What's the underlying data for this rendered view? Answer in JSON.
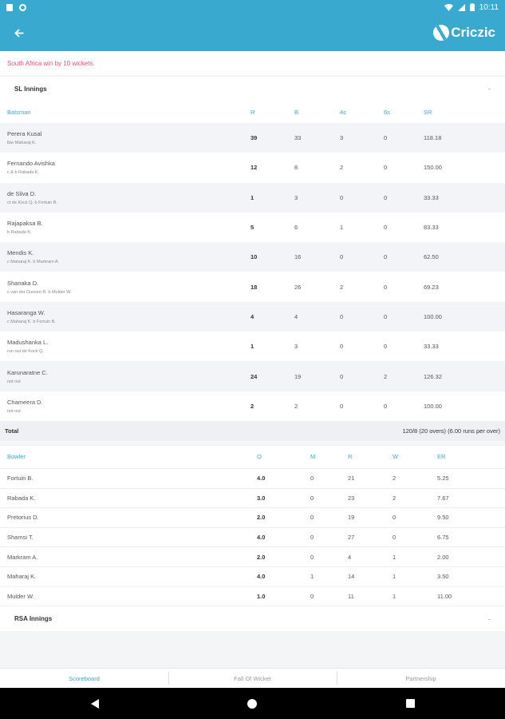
{
  "status_bar": {
    "time": "10:11"
  },
  "app": {
    "logo_text": "Criczic"
  },
  "result_text": "South Africa win by 10 wickets.",
  "sl_innings": {
    "title": "SL Innings",
    "toggle": "-",
    "headers": {
      "batsman": "Batsman",
      "r": "R",
      "b": "B",
      "fours": "4s",
      "sixes": "6s",
      "sr": "SR"
    },
    "rows": [
      {
        "name": "Perera Kusal",
        "dismissal": "lbw Maharaj K.",
        "r": "39",
        "b": "33",
        "fours": "3",
        "sixes": "0",
        "sr": "118.18"
      },
      {
        "name": "Fernando Avishka",
        "dismissal": "c & b Rabada K.",
        "r": "12",
        "b": "8",
        "fours": "2",
        "sixes": "0",
        "sr": "150.00"
      },
      {
        "name": "de Silva D.",
        "dismissal": "ct de Kock Q. b Fortuin B.",
        "r": "1",
        "b": "3",
        "fours": "0",
        "sixes": "0",
        "sr": "33.33"
      },
      {
        "name": "Rajapaksa B.",
        "dismissal": "b Rabada K.",
        "r": "5",
        "b": "6",
        "fours": "1",
        "sixes": "0",
        "sr": "83.33"
      },
      {
        "name": "Mendis K.",
        "dismissal": "c Maharaj K. b Markram A.",
        "r": "10",
        "b": "16",
        "fours": "0",
        "sixes": "0",
        "sr": "62.50"
      },
      {
        "name": "Shanaka D.",
        "dismissal": "c van der Dussen R. b Mulder W.",
        "r": "18",
        "b": "26",
        "fours": "2",
        "sixes": "0",
        "sr": "69.23"
      },
      {
        "name": "Hasaranga W.",
        "dismissal": "c Maharaj K. b Fortuin B.",
        "r": "4",
        "b": "4",
        "fours": "0",
        "sixes": "0",
        "sr": "100.00"
      },
      {
        "name": "Madushanka L.",
        "dismissal": "run out de Kock Q.",
        "r": "1",
        "b": "3",
        "fours": "0",
        "sixes": "0",
        "sr": "33.33"
      },
      {
        "name": "Karunaratne C.",
        "dismissal": "not out",
        "r": "24",
        "b": "19",
        "fours": "0",
        "sixes": "2",
        "sr": "126.32"
      },
      {
        "name": "Chameera D.",
        "dismissal": "not out",
        "r": "2",
        "b": "2",
        "fours": "0",
        "sixes": "0",
        "sr": "100.00"
      }
    ],
    "total_label": "Total",
    "total_value": "120/8 (20 overs) (6.00 runs per over)",
    "bowl_headers": {
      "bowler": "Bowler",
      "o": "O",
      "m": "M",
      "r": "R",
      "w": "W",
      "er": "ER"
    },
    "bowlers": [
      {
        "name": "Fortuin B.",
        "o": "4.0",
        "m": "0",
        "r": "21",
        "w": "2",
        "er": "5.25"
      },
      {
        "name": "Rabada K.",
        "o": "3.0",
        "m": "0",
        "r": "23",
        "w": "2",
        "er": "7.67"
      },
      {
        "name": "Pretorius D.",
        "o": "2.0",
        "m": "0",
        "r": "19",
        "w": "0",
        "er": "9.50"
      },
      {
        "name": "Shamsi T.",
        "o": "4.0",
        "m": "0",
        "r": "27",
        "w": "0",
        "er": "6.75"
      },
      {
        "name": "Markram A.",
        "o": "2.0",
        "m": "0",
        "r": "4",
        "w": "1",
        "er": "2.00"
      },
      {
        "name": "Maharaj K.",
        "o": "4.0",
        "m": "1",
        "r": "14",
        "w": "1",
        "er": "3.50"
      },
      {
        "name": "Mulder W.",
        "o": "1.0",
        "m": "0",
        "r": "11",
        "w": "1",
        "er": "11.00"
      }
    ]
  },
  "rsa_innings": {
    "title": "RSA Innings",
    "toggle": "-"
  },
  "tabs": [
    "Scoreboard",
    "Fall Of Wicket",
    "Partnership"
  ],
  "colors": {
    "primary": "#3aa9cf",
    "result": "#ef5077"
  }
}
